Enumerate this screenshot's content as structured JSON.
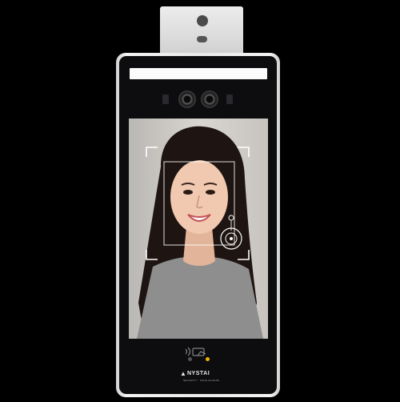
{
  "device": {
    "brand_mark": "▲",
    "brand_name": "NYSTAI",
    "brand_tagline": "SECURITY · FACE ACCESS",
    "status_led_color": "#f0b400",
    "frame_color": "#ececec",
    "screen_face_box_color": "#ffffff"
  },
  "icons": {
    "sensor": "thermal-sensor-icon",
    "camera": "camera-lens-icon",
    "card": "card-tap-icon",
    "brand": "nystai-logo-icon"
  }
}
